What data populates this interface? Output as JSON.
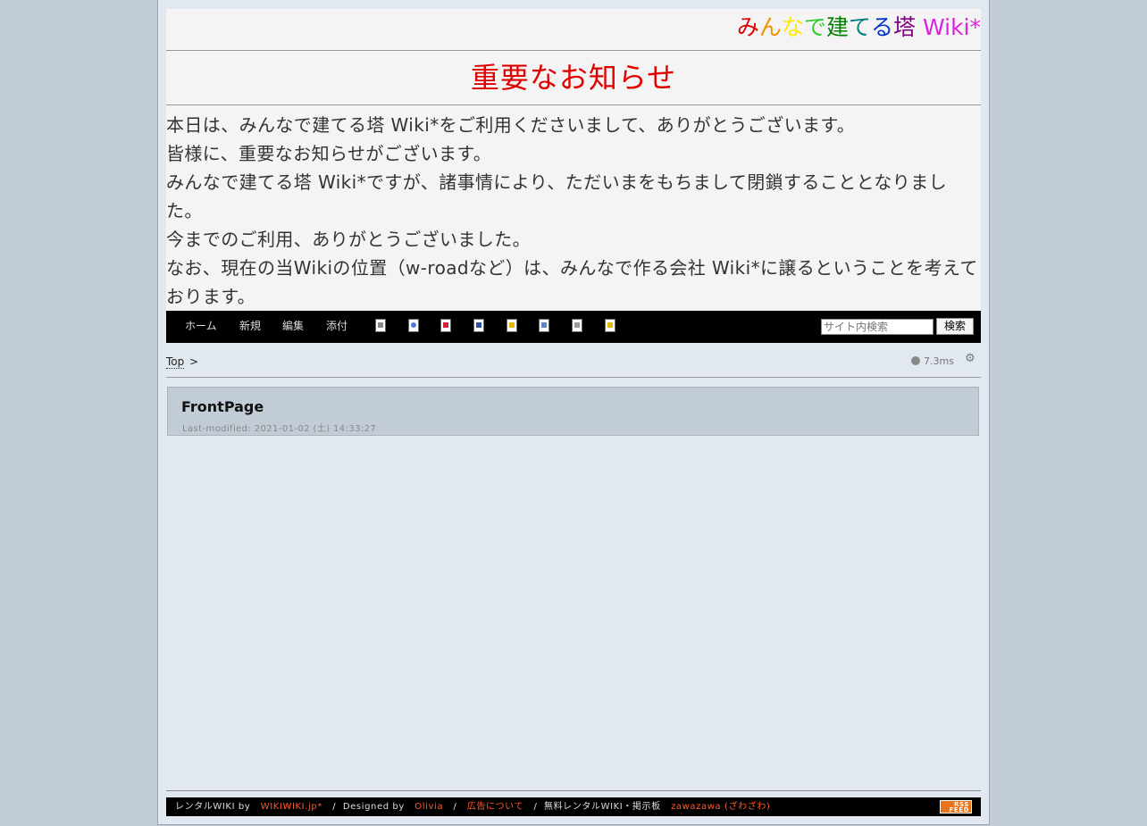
{
  "site": {
    "title_chars": [
      {
        "ch": "み",
        "color": "#e00000"
      },
      {
        "ch": "ん",
        "color": "#f29200"
      },
      {
        "ch": "な",
        "color": "#ffe900"
      },
      {
        "ch": "で",
        "color": "#33cc33"
      },
      {
        "ch": "建",
        "color": "#008000"
      },
      {
        "ch": "て",
        "color": "#008080"
      },
      {
        "ch": "る",
        "color": "#0033cc"
      },
      {
        "ch": "塔",
        "color": "#800080"
      },
      {
        "ch": " Wiki*",
        "color": "#dd22dd"
      }
    ]
  },
  "notice": {
    "heading": "重要なお知らせ",
    "lines": [
      "本日は、みんなで建てる塔 Wiki*をご利用くださいまして、ありがとうございます。",
      "皆様に、重要なお知らせがございます。",
      "みんなで建てる塔 Wiki*ですが、諸事情により、ただいまをもちまして閉鎖することとなりまし",
      "た。",
      "今までのご利用、ありがとうございました。",
      "なお、現在の当Wikiの位置（w-roadなど）は、みんなで作る会社 Wiki*に譲るということを考えて",
      "おります。"
    ]
  },
  "nav": {
    "home": "ホーム",
    "new": "新規",
    "edit": "編集",
    "attach": "添付",
    "icons": [
      "list-icon",
      "search-doc-icon",
      "recent-icon",
      "backup-icon",
      "freeze-icon",
      "diff-icon",
      "new-doc-icon",
      "help-icon"
    ],
    "search_placeholder": "サイト内検索",
    "search_button": "検索"
  },
  "breadcrumb": {
    "top": "Top",
    "separator": ">"
  },
  "status": {
    "timing": "7.3ms"
  },
  "page": {
    "title": "FrontPage",
    "last_modified": "Last-modified: 2021-01-02 (土) 14:33:27"
  },
  "footer": {
    "rental_label": "レンタルWIKI by",
    "wikiwiki": "WIKIWIKI.jp*",
    "sep": "/",
    "designed_by": "Designed by",
    "olivia": "Olivia",
    "ads": "広告について",
    "free_rental": "無料レンタルWIKI・掲示板",
    "zawazawa": "zawazawa (ざわざわ)",
    "rss_line1": "RSS",
    "rss_line2": "FEED"
  }
}
